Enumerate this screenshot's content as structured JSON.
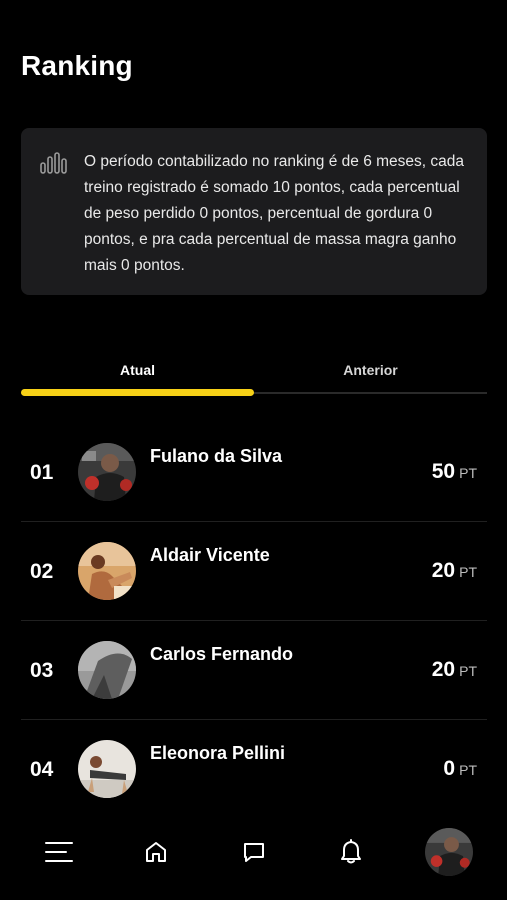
{
  "header": {
    "title": "Ranking"
  },
  "info_card": {
    "icon": "bar-chart-icon",
    "text": "O período contabilizado no ranking é de 6 meses, cada treino registrado é somado 10 pontos, cada percentual de peso perdido 0 pontos, percentual de gordura 0 pontos, e pra cada percentual de massa magra ganho mais 0 pontos."
  },
  "tabs": [
    {
      "label": "Atual",
      "active": true
    },
    {
      "label": "Anterior",
      "active": false
    }
  ],
  "ranking": [
    {
      "position": "01",
      "name": "Fulano da Silva",
      "points": "50",
      "unit": "PT"
    },
    {
      "position": "02",
      "name": "Aldair Vicente",
      "points": "20",
      "unit": "PT"
    },
    {
      "position": "03",
      "name": "Carlos Fernando",
      "points": "20",
      "unit": "PT"
    },
    {
      "position": "04",
      "name": "Eleonora Pellini",
      "points": "0",
      "unit": "PT"
    }
  ],
  "bottom_nav": {
    "items": [
      {
        "icon": "menu-icon"
      },
      {
        "icon": "home-icon"
      },
      {
        "icon": "chat-icon"
      },
      {
        "icon": "bell-icon"
      },
      {
        "icon": "profile-avatar"
      }
    ]
  },
  "colors": {
    "background": "#000000",
    "card": "#1c1c1e",
    "accent": "#f7d117",
    "text": "#ffffff"
  }
}
